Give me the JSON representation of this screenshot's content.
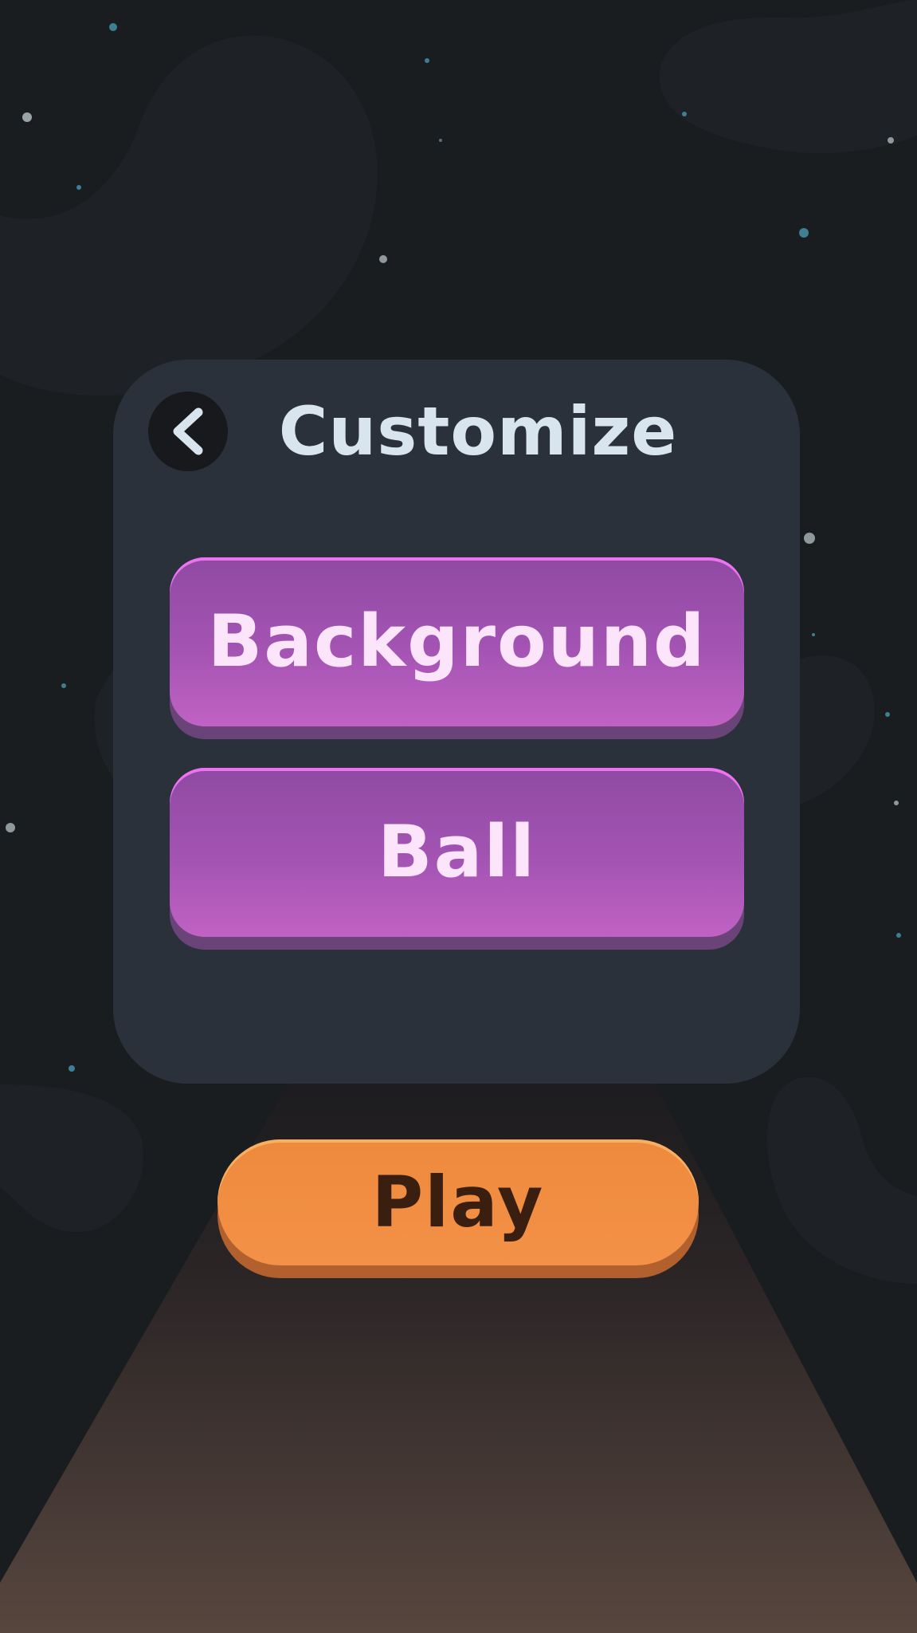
{
  "screen": {
    "title": "Customize"
  },
  "back_button": {
    "icon": "chevron-left-icon"
  },
  "menu": {
    "background_label": "Background",
    "ball_label": "Ball"
  },
  "play_button": {
    "label": "Play"
  },
  "colors": {
    "backdrop": "#1a1d20",
    "panel": "#2a313a",
    "title_text": "#d8e4ee",
    "menu_button": "#a454b3",
    "menu_button_text": "#fce4fb",
    "play_button": "#f0893c",
    "play_button_text": "#3a1f10",
    "track": "#57463e"
  }
}
